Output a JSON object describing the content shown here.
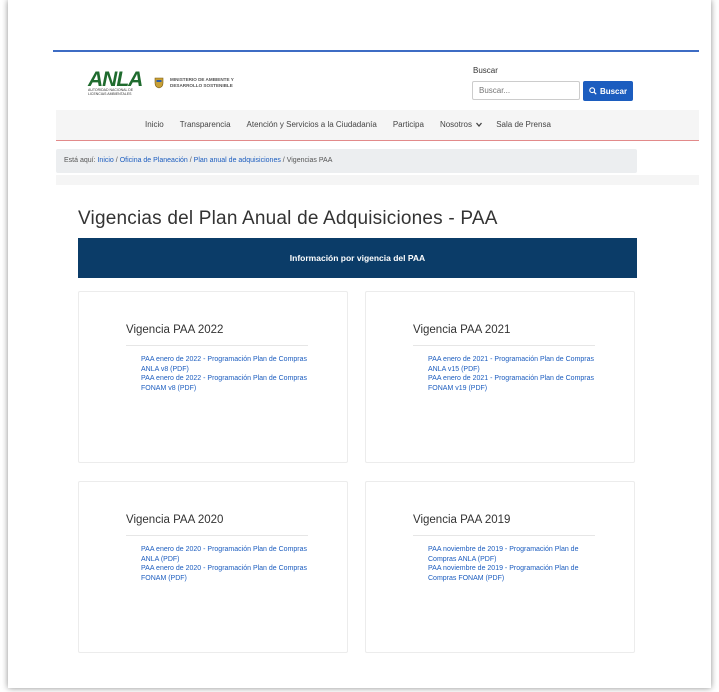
{
  "header": {
    "logo": "ANLA",
    "logo_subtitle": "AUTORIDAD NACIONAL DE LICENCIAS AMBIENTALES",
    "ministry_line1": "MINISTERIO DE AMBIENTE Y",
    "ministry_line2": "DESARROLLO SOSTENIBLE"
  },
  "search": {
    "label": "Buscar",
    "placeholder": "Buscar...",
    "button_label": "Buscar"
  },
  "nav": {
    "items": [
      {
        "label": "Inicio"
      },
      {
        "label": "Transparencia"
      },
      {
        "label": "Atención y Servicios a la Ciudadanía"
      },
      {
        "label": "Participa"
      },
      {
        "label": "Nosotros"
      },
      {
        "label": "Sala de Prensa"
      }
    ]
  },
  "breadcrumb": {
    "prefix": "Está aquí:",
    "items": [
      "Inicio",
      "Oficina de Planeación",
      "Plan anual de adquisiciones",
      "Vigencias PAA"
    ],
    "separator": "/"
  },
  "page": {
    "title": "Vigencias del Plan Anual de Adquisiciones - PAA",
    "section_header": "Información por vigencia del PAA"
  },
  "cards": [
    {
      "title": "Vigencia PAA 2022",
      "links": [
        "PAA enero de 2022 - Programación Plan de Compras ANLA v8 (PDF)",
        "PAA enero de 2022 - Programación Plan de Compras FONAM v8 (PDF)"
      ]
    },
    {
      "title": "Vigencia PAA 2021",
      "links": [
        "PAA enero de 2021 - Programación Plan de Compras ANLA v15 (PDF)",
        "PAA enero de 2021 - Programación Plan de Compras FONAM v19 (PDF)"
      ]
    },
    {
      "title": "Vigencia PAA 2020",
      "links": [
        "PAA enero de 2020 - Programación Plan de Compras ANLA (PDF)",
        "PAA enero de 2020 - Programación Plan de Compras FONAM (PDF)"
      ]
    },
    {
      "title": "Vigencia PAA 2019",
      "links": [
        "PAA noviembre de 2019 - Programación Plan de Compras ANLA (PDF)",
        "PAA noviembre de 2019 - Programación Plan de Compras FONAM (PDF)"
      ]
    }
  ],
  "colors": {
    "accent_blue": "#1c5dbf",
    "header_navy": "#0b3c68",
    "logo_green": "#1f6b2e"
  }
}
